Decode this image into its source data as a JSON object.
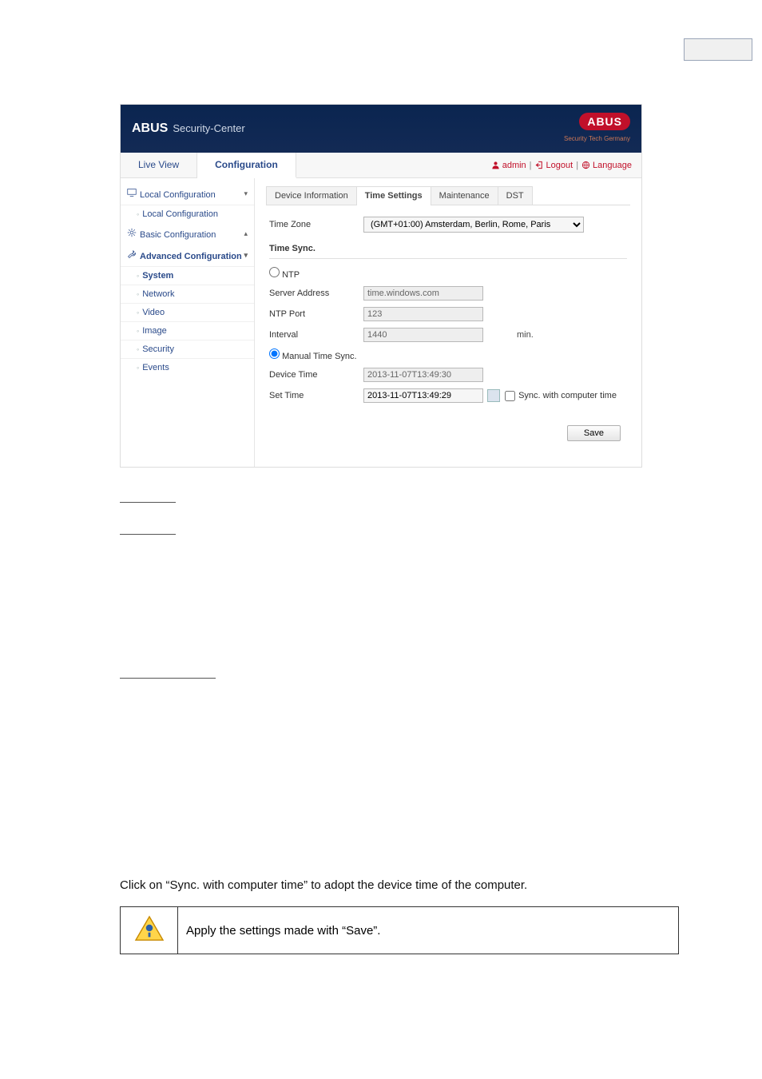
{
  "header": {
    "brand_bold": "ABUS",
    "brand_rest": "Security-Center",
    "logo_text": "ABUS",
    "logo_sub": "Security Tech Germany"
  },
  "top_nav": {
    "tabs": {
      "live": "Live View",
      "config": "Configuration"
    },
    "right": {
      "admin": "admin",
      "logout": "Logout",
      "language": "Language"
    }
  },
  "sidebar": {
    "g_local": "Local Configuration",
    "i_local": "Local Configuration",
    "g_basic": "Basic Configuration",
    "g_adv": "Advanced Configuration",
    "items": {
      "system": "System",
      "network": "Network",
      "video": "Video",
      "image": "Image",
      "security": "Security",
      "events": "Events"
    }
  },
  "subtabs": {
    "dev": "Device Information",
    "time": "Time Settings",
    "maint": "Maintenance",
    "dst": "DST"
  },
  "form": {
    "tz_label": "Time Zone",
    "tz_value": "(GMT+01:00) Amsterdam, Berlin, Rome, Paris",
    "section": "Time Sync.",
    "ntp_radio": "NTP",
    "server_label": "Server Address",
    "server_value": "time.windows.com",
    "port_label": "NTP Port",
    "port_value": "123",
    "interval_label": "Interval",
    "interval_value": "1440",
    "interval_unit": "min.",
    "manual_radio": "Manual Time Sync.",
    "devtime_label": "Device Time",
    "devtime_value": "2013-11-07T13:49:30",
    "settime_label": "Set Time",
    "settime_value": "2013-11-07T13:49:29",
    "sync_chk": "Sync. with computer time",
    "save": "Save"
  },
  "doc": {
    "instruction": "Click on “Sync. with computer time” to adopt the device time of the computer.",
    "note": "Apply the settings made with “Save”."
  }
}
